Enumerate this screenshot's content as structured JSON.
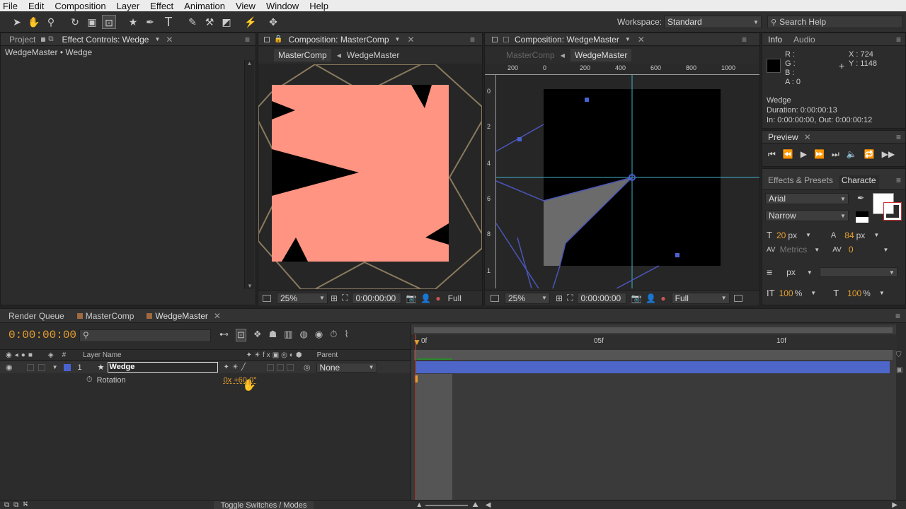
{
  "menu": [
    "File",
    "Edit",
    "Composition",
    "Layer",
    "Effect",
    "Animation",
    "View",
    "Window",
    "Help"
  ],
  "toolbar": {
    "workspace_label": "Workspace:",
    "workspace_value": "Standard",
    "search_placeholder": "Search Help"
  },
  "left_panel": {
    "tab_project": "Project",
    "tab_effect_controls": "Effect Controls: Wedge",
    "breadcrumb": "WedgeMaster • Wedge"
  },
  "comp1": {
    "tab": "Composition: MasterComp",
    "crumb_active": "MasterComp",
    "crumb_child": "WedgeMaster",
    "zoom": "25%",
    "timecode": "0:00:00:00",
    "resolution": "Full",
    "bg_color": "#ff9482"
  },
  "comp2": {
    "tab": "Composition: WedgeMaster",
    "crumb_parent": "MasterComp",
    "crumb_active": "WedgeMaster",
    "zoom": "25%",
    "timecode": "0:00:00:00",
    "resolution": "Full",
    "ruler_h": [
      "200",
      "0",
      "200",
      "400",
      "600",
      "800",
      "1000"
    ],
    "ruler_v": [
      "0",
      "2",
      "4",
      "6",
      "8",
      "1"
    ]
  },
  "info": {
    "tab_info": "Info",
    "tab_audio": "Audio",
    "r": "R :",
    "g": "G :",
    "b": "B :",
    "a": "A : 0",
    "x": "X : 724",
    "y": "Y : 1148",
    "layer_name": "Wedge",
    "duration": "Duration: 0:00:00:13",
    "inout": "In: 0:00:00:00, Out: 0:00:00:12"
  },
  "preview": {
    "tab": "Preview"
  },
  "effects": {
    "tab_effects": "Effects & Presets",
    "tab_character": "Characte"
  },
  "character": {
    "font": "Arial",
    "style": "Narrow",
    "size": "20",
    "size_unit": "px",
    "leading": "84",
    "leading_unit": "px",
    "kerning": "Metrics",
    "tracking": "0",
    "stroke_unit": "px",
    "vscale": "100",
    "hscale": "100",
    "pct": "%"
  },
  "timeline": {
    "tab_render": "Render Queue",
    "tab_master": "MasterComp",
    "tab_wedge": "WedgeMaster",
    "timecode": "0:00:00:00",
    "col_hash": "#",
    "col_layer_name": "Layer Name",
    "col_parent": "Parent",
    "layer_index": "1",
    "layer_name": "Wedge",
    "parent_value": "None",
    "property_name": "Rotation",
    "property_value": "0x +60.0°",
    "ruler_marks": [
      "0f",
      "05f",
      "10f"
    ],
    "toggle_label": "Toggle Switches / Modes"
  }
}
